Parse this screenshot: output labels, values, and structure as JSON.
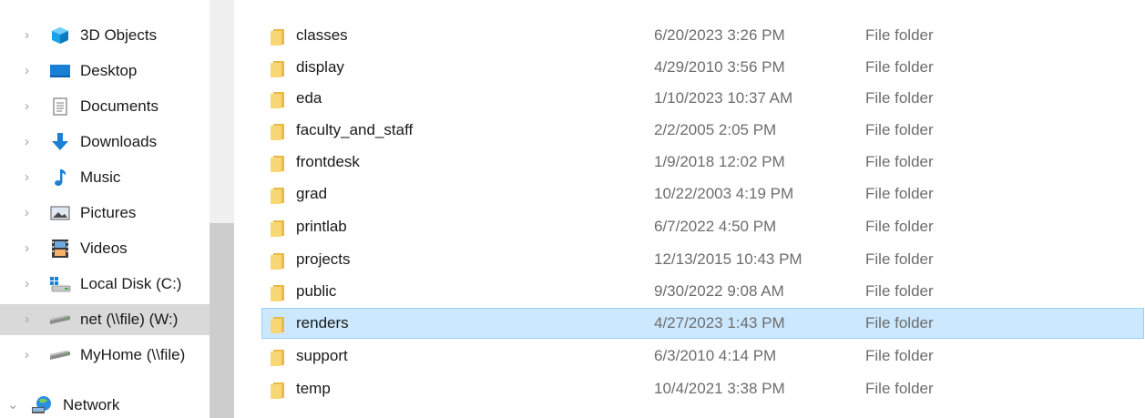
{
  "nav": {
    "items": [
      {
        "label": "3D Objects",
        "icon": "3d-objects-icon"
      },
      {
        "label": "Desktop",
        "icon": "desktop-icon"
      },
      {
        "label": "Documents",
        "icon": "documents-icon"
      },
      {
        "label": "Downloads",
        "icon": "downloads-icon"
      },
      {
        "label": "Music",
        "icon": "music-icon"
      },
      {
        "label": "Pictures",
        "icon": "pictures-icon"
      },
      {
        "label": "Videos",
        "icon": "videos-icon"
      },
      {
        "label": "Local Disk (C:)",
        "icon": "local-disk-icon"
      },
      {
        "label": "net (\\\\file) (W:)",
        "icon": "network-drive-icon",
        "selected": true
      },
      {
        "label": "MyHome (\\\\file)",
        "icon": "network-drive-icon"
      },
      {
        "label": "Network",
        "icon": "network-icon",
        "expanded": true
      }
    ]
  },
  "files": [
    {
      "name": "classes",
      "date": "6/20/2023 3:26 PM",
      "type": "File folder"
    },
    {
      "name": "display",
      "date": "4/29/2010 3:56 PM",
      "type": "File folder"
    },
    {
      "name": "eda",
      "date": "1/10/2023 10:37 AM",
      "type": "File folder"
    },
    {
      "name": "faculty_and_staff",
      "date": "2/2/2005 2:05 PM",
      "type": "File folder"
    },
    {
      "name": "frontdesk",
      "date": "1/9/2018 12:02 PM",
      "type": "File folder"
    },
    {
      "name": "grad",
      "date": "10/22/2003 4:19 PM",
      "type": "File folder"
    },
    {
      "name": "printlab",
      "date": "6/7/2022 4:50 PM",
      "type": "File folder"
    },
    {
      "name": "projects",
      "date": "12/13/2015 10:43 PM",
      "type": "File folder"
    },
    {
      "name": "public",
      "date": "9/30/2022 9:08 AM",
      "type": "File folder"
    },
    {
      "name": "renders",
      "date": "4/27/2023 1:43 PM",
      "type": "File folder",
      "selected": true
    },
    {
      "name": "support",
      "date": "6/3/2010 4:14 PM",
      "type": "File folder"
    },
    {
      "name": "temp",
      "date": "10/4/2021 3:38 PM",
      "type": "File folder"
    }
  ],
  "colors": {
    "selected_row": "#cce8ff",
    "selected_row_border": "#99d1ff",
    "folder": "#f8d775",
    "nav_selected": "#d9d9d9"
  }
}
